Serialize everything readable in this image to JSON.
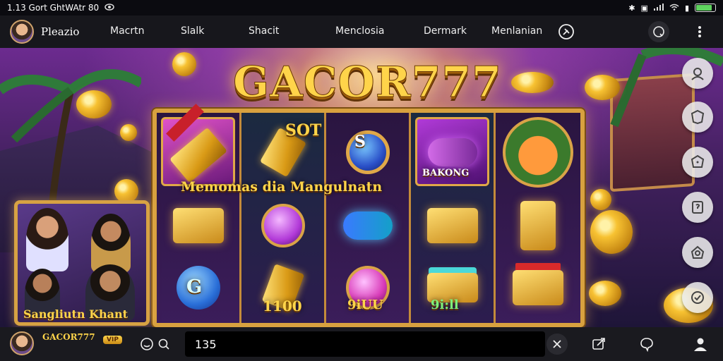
{
  "status_bar": {
    "time_text": "1.13 Gort GhtWAtr 80",
    "battery_level": 0.85
  },
  "top_nav": {
    "brand": "Pleazio",
    "items": [
      "Macrtn",
      "Slalk",
      "Shacit",
      "Menclosia",
      "Dermark",
      "Menlanian"
    ]
  },
  "game": {
    "title": "GACOR777",
    "reel_text": {
      "sot": "SOT",
      "overlay": "Memomas dia Mangulnatn",
      "bakong": "BAKONG",
      "r3": "1100",
      "r4": "9iUU",
      "r5": "9i:ll"
    },
    "promo_card_label": "Sangliutn  Khant"
  },
  "bottom_bar": {
    "username": "GACOR777",
    "badge": "VIP",
    "input_value": "135"
  },
  "colors": {
    "gold": "#ffd54a",
    "frame": "#d8a13f",
    "bar_bg": "#1a1a1f"
  }
}
